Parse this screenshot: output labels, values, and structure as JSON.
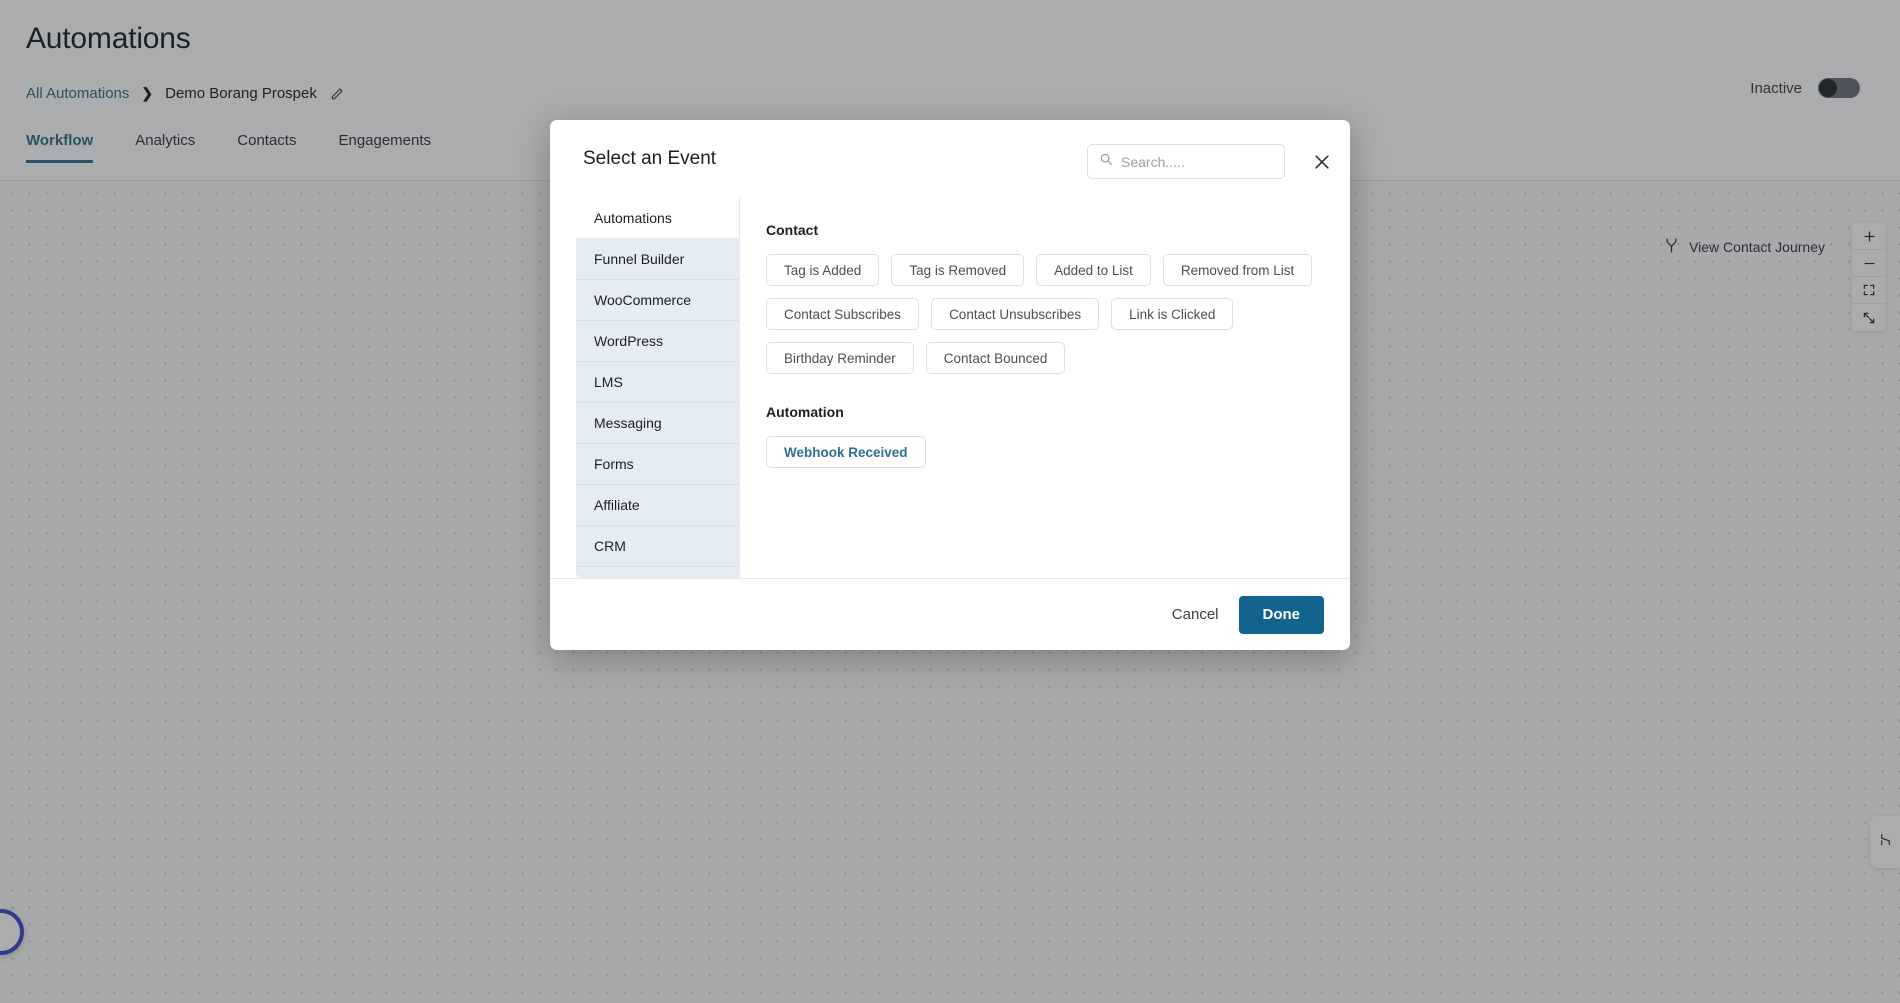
{
  "page": {
    "title": "Automations",
    "breadcrumb": {
      "root_label": "All Automations",
      "separator": "›",
      "current_label": "Demo Borang Prospek",
      "edit_icon": "pencil-icon"
    },
    "status": {
      "label": "Inactive",
      "toggle_on": false
    },
    "tabs": [
      {
        "label": "Workflow",
        "active": true
      },
      {
        "label": "Analytics",
        "active": false
      },
      {
        "label": "Contacts",
        "active": false
      },
      {
        "label": "Engagements",
        "active": false
      }
    ]
  },
  "canvas": {
    "contact_journey_label": "View Contact Journey",
    "contact_journey_icon": "branch-fork-icon",
    "zoom_controls": [
      {
        "name": "zoom-in",
        "glyph": "+"
      },
      {
        "name": "zoom-out",
        "glyph": "−"
      },
      {
        "name": "fit-view",
        "glyph": "fit-icon"
      },
      {
        "name": "fullscreen",
        "glyph": "expand-icon"
      }
    ],
    "minimap_icon": "connector-icon",
    "help_icon": "help-bubble-icon"
  },
  "modal": {
    "title": "Select an Event",
    "search": {
      "placeholder": "Search.....",
      "value": "",
      "icon": "search-icon"
    },
    "close_icon": "close-icon",
    "categories": [
      {
        "label": "Automations",
        "active": true
      },
      {
        "label": "Funnel Builder",
        "active": false
      },
      {
        "label": "WooCommerce",
        "active": false
      },
      {
        "label": "WordPress",
        "active": false
      },
      {
        "label": "LMS",
        "active": false
      },
      {
        "label": "Messaging",
        "active": false
      },
      {
        "label": "Forms",
        "active": false
      },
      {
        "label": "Affiliate",
        "active": false
      },
      {
        "label": "CRM",
        "active": false
      }
    ],
    "groups": [
      {
        "title": "Contact",
        "events": [
          {
            "label": "Tag is Added",
            "selected": false
          },
          {
            "label": "Tag is Removed",
            "selected": false
          },
          {
            "label": "Added to List",
            "selected": false
          },
          {
            "label": "Removed from List",
            "selected": false
          },
          {
            "label": "Contact Subscribes",
            "selected": false
          },
          {
            "label": "Contact Unsubscribes",
            "selected": false
          },
          {
            "label": "Link is Clicked",
            "selected": false
          },
          {
            "label": "Birthday Reminder",
            "selected": false
          },
          {
            "label": "Contact Bounced",
            "selected": false
          }
        ]
      },
      {
        "title": "Automation",
        "events": [
          {
            "label": "Webhook Received",
            "selected": true
          }
        ]
      }
    ],
    "footer": {
      "cancel_label": "Cancel",
      "done_label": "Done"
    }
  },
  "colors": {
    "accent_blue": "#2f6e8f",
    "primary_button": "#12638e",
    "sidebar_bg": "#e5ecf4"
  }
}
